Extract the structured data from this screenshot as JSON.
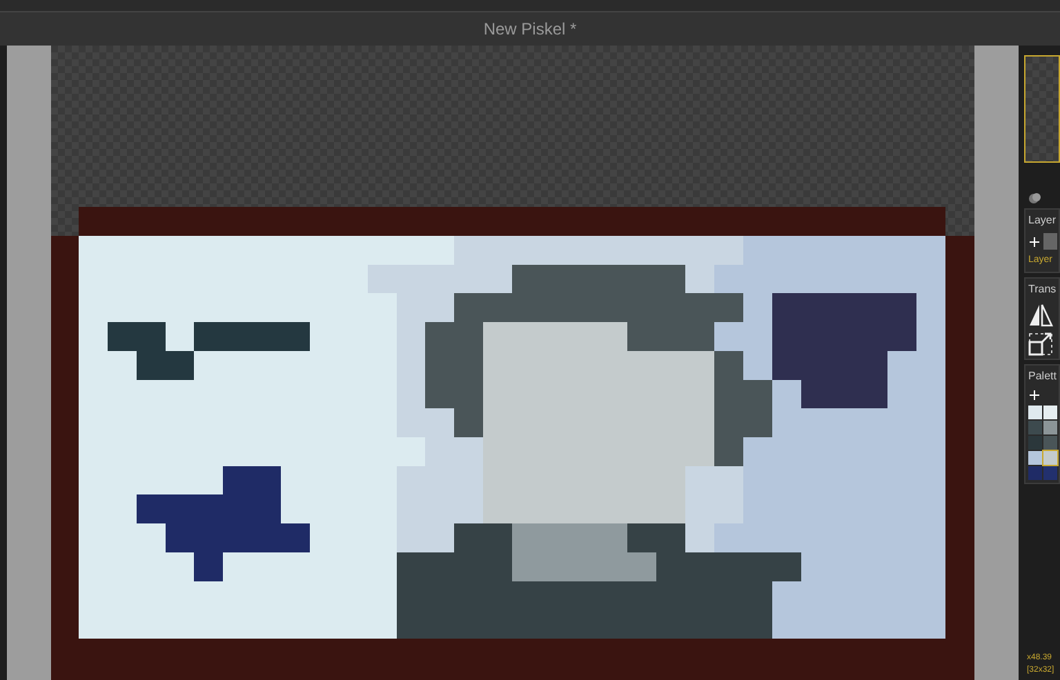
{
  "window": {
    "title": "New Piskel *"
  },
  "layers": {
    "title": "Layer",
    "items": [
      {
        "name": "Layer",
        "selected": true
      }
    ]
  },
  "transform": {
    "title": "Trans"
  },
  "palettes": {
    "title": "Palett",
    "swatches": [
      {
        "color": "#dfe9ee",
        "selected": false
      },
      {
        "color": "#e6eef1",
        "selected": false
      },
      {
        "color": "#3d4a4e",
        "selected": false
      },
      {
        "color": "#8c9598",
        "selected": false
      },
      {
        "color": "#2b373b",
        "selected": false
      },
      {
        "color": "#4a5558",
        "selected": false
      },
      {
        "color": "#b5c6dc",
        "selected": false
      },
      {
        "color": "#c4cbcc",
        "selected": true
      },
      {
        "color": "#1f2b66",
        "selected": false
      },
      {
        "color": "#22306e",
        "selected": false
      }
    ]
  },
  "status": {
    "cursor": "x48.39",
    "size": "[32x32]"
  }
}
